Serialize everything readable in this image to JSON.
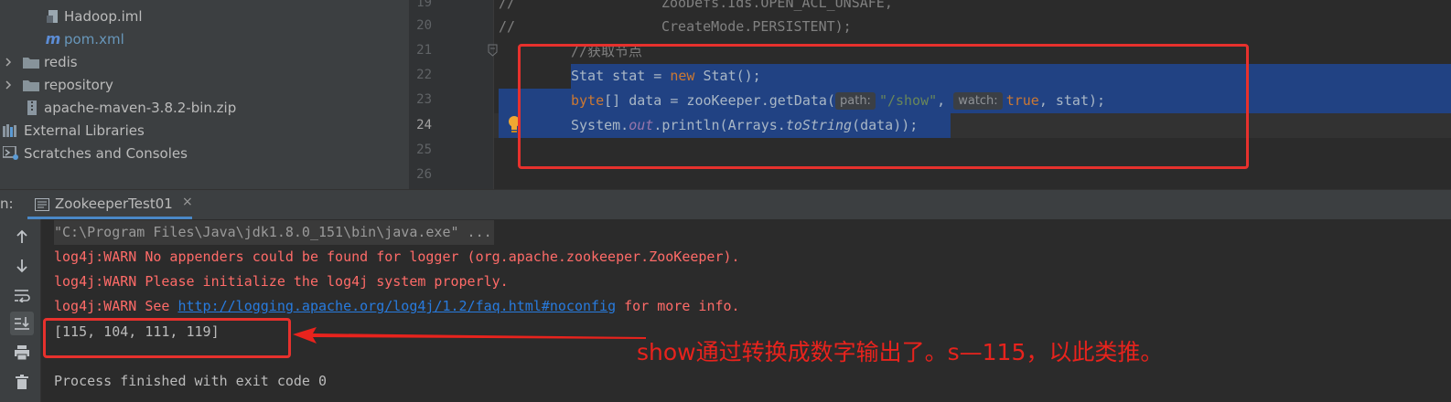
{
  "project_tree": {
    "items": [
      {
        "label": "Hadoop.iml",
        "icon": "module-file-icon"
      },
      {
        "label": "pom.xml",
        "icon": "maven-m-icon"
      },
      {
        "label": "redis",
        "icon": "folder-icon"
      },
      {
        "label": "repository",
        "icon": "folder-icon"
      },
      {
        "label": "apache-maven-3.8.2-bin.zip",
        "icon": "zip-archive-icon"
      },
      {
        "label": "External Libraries",
        "icon": "libraries-icon"
      },
      {
        "label": "Scratches and Consoles",
        "icon": "scratches-icon"
      }
    ]
  },
  "editor": {
    "line_numbers": [
      "19",
      "20",
      "21",
      "22",
      "23",
      "24",
      "25",
      "26"
    ],
    "current_line": "24",
    "lines": {
      "l19_comment": "//",
      "l19_code": "ZooDefs.Ids.OPEN_ACL_UNSAFE,",
      "l20_comment": "//",
      "l20_code": "CreateMode.PERSISTENT);",
      "l21_comment": "//获取节点",
      "l22_kw_plain": "Stat stat = ",
      "l22_kw_new": "new",
      "l22_rest": " Stat();",
      "l23_kw_byte": "byte",
      "l23_a": "[] data = zooKeeper.getData(",
      "l23_hint_path": "path:",
      "l23_str": "\"/show\"",
      "l23_comma": ", ",
      "l23_hint_watch": "watch:",
      "l23_kw_true": "true",
      "l23_end": ", stat);",
      "l24_a": "System.",
      "l24_out": "out",
      "l24_b": ".println(Arrays.",
      "l24_tostring": "toString",
      "l24_c": "(data));"
    }
  },
  "run_panel": {
    "prefix": "n:",
    "tab_label": "ZookeeperTest01",
    "close_glyph": "×",
    "console": {
      "cmd": "\"C:\\Program Files\\Java\\jdk1.8.0_151\\bin\\java.exe\" ...",
      "warn1": "log4j:WARN No appenders could be found for logger (org.apache.zookeeper.ZooKeeper).",
      "warn2": "log4j:WARN Please initialize the log4j system properly.",
      "warn3_prefix": "log4j:WARN See ",
      "warn3_link": "http://logging.apache.org/log4j/1.2/faq.html#noconfig",
      "warn3_suffix": " for more info.",
      "output": "[115, 104, 111, 119]",
      "exit": "Process finished with exit code 0"
    },
    "toolbar": [
      "up-arrow-icon",
      "down-arrow-icon",
      "soft-wrap-icon",
      "scroll-to-end-icon",
      "print-icon",
      "trash-icon"
    ]
  },
  "annotation": {
    "text": "show通过转换成数字输出了。s—115，以此类推。",
    "color": "#e8231d"
  },
  "colors": {
    "selection": "#214283",
    "keyword": "#cc7832",
    "string": "#6a8759",
    "warn": "#ff6b68",
    "link": "#287bde"
  }
}
